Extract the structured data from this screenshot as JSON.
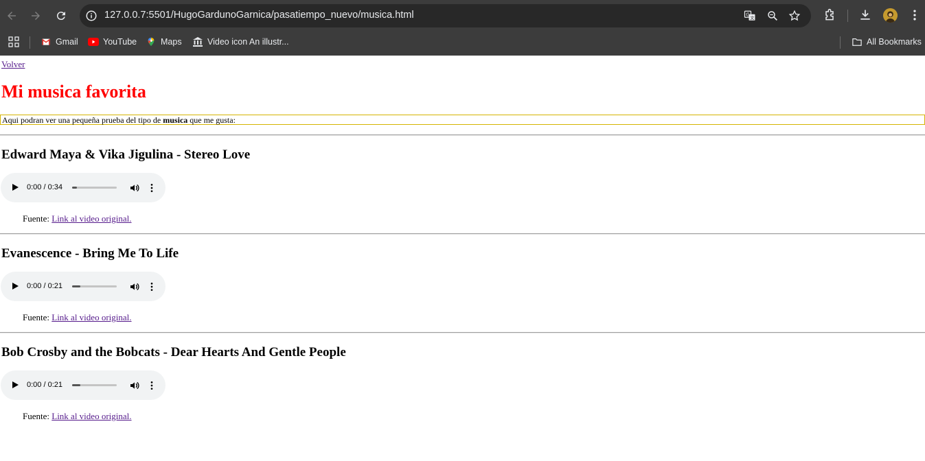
{
  "browser": {
    "url": "127.0.0.7:5501/HugoGardunoGarnica/pasatiempo_nuevo/musica.html",
    "bookmarks": [
      {
        "label": "Gmail",
        "icon": "gmail-icon"
      },
      {
        "label": "YouTube",
        "icon": "youtube-icon"
      },
      {
        "label": "Maps",
        "icon": "maps-icon"
      },
      {
        "label": "Video icon An illustr...",
        "icon": "museum-icon"
      }
    ],
    "all_bookmarks_label": "All Bookmarks"
  },
  "page": {
    "back_link": "Volver",
    "title": "Mi musica favorita",
    "intro": {
      "before": "Aqui podran ver una pequeña prueba del tipo de ",
      "bold": "musica",
      "after": " que me gusta:"
    },
    "songs": [
      {
        "title": "Edward Maya & Vika Jigulina - Stereo Love",
        "time": "0:00 / 0:34",
        "progress": 0.1,
        "source_label": "Fuente: ",
        "source_link": "Link al video original."
      },
      {
        "title": "Evanescence - Bring Me To Life",
        "time": "0:00 / 0:21",
        "progress": 0.18,
        "source_label": "Fuente: ",
        "source_link": "Link al video original."
      },
      {
        "title": "Bob Crosby and the Bobcats - Dear Hearts And Gentle People",
        "time": "0:00 / 0:21",
        "progress": 0.18,
        "source_label": "Fuente: ",
        "source_link": "Link al video original."
      }
    ]
  },
  "colors": {
    "title": "#ff0000",
    "link": "#551a8b",
    "intro_border": "#d4b400",
    "chrome_bg": "#3c3c3c"
  }
}
